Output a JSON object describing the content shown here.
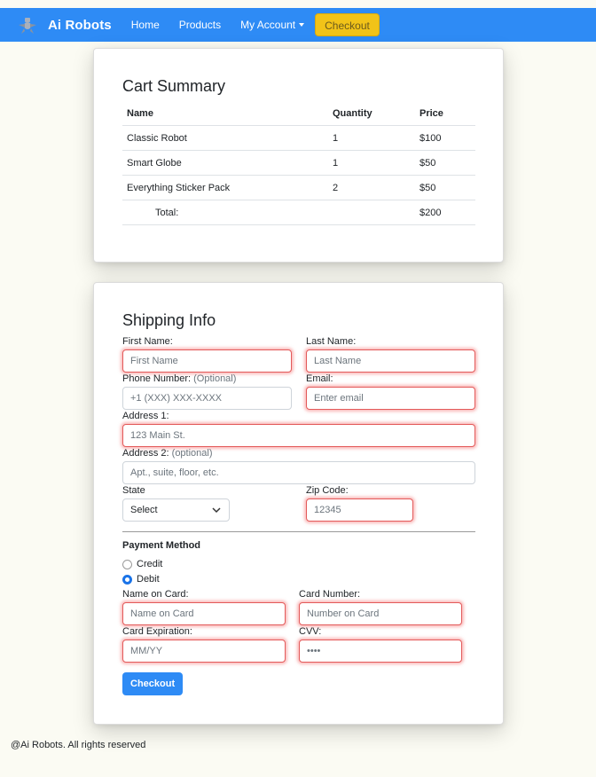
{
  "navbar": {
    "brand": "Ai Robots",
    "links": [
      "Home",
      "Products",
      "My Account"
    ],
    "checkout": "Checkout"
  },
  "cart": {
    "title": "Cart Summary",
    "headers": [
      "Name",
      "Quantity",
      "Price"
    ],
    "rows": [
      {
        "name": "Classic Robot",
        "qty": "1",
        "price": "$100"
      },
      {
        "name": "Smart Globe",
        "qty": "1",
        "price": "$50"
      },
      {
        "name": "Everything Sticker Pack",
        "qty": "2",
        "price": "$50"
      }
    ],
    "total_label": "Total:",
    "total_value": "$200"
  },
  "shipping": {
    "title": "Shipping Info",
    "first_name": {
      "label": "First Name:",
      "placeholder": "First Name"
    },
    "last_name": {
      "label": "Last Name:",
      "placeholder": "Last Name"
    },
    "phone": {
      "label": "Phone Number:",
      "optional": "(Optional)",
      "placeholder": "+1 (XXX) XXX-XXXX"
    },
    "email": {
      "label": "Email:",
      "placeholder": "Enter email"
    },
    "address1": {
      "label": "Address 1:",
      "placeholder": "123 Main St."
    },
    "address2": {
      "label": "Address 2:",
      "optional": "(optional)",
      "placeholder": "Apt., suite, floor, etc."
    },
    "state": {
      "label": "State",
      "value": "Select"
    },
    "zip": {
      "label": "Zip Code:",
      "placeholder": "12345"
    }
  },
  "payment": {
    "label": "Payment Method",
    "options": [
      "Credit",
      "Debit"
    ],
    "selected": "Debit",
    "name_on_card": {
      "label": "Name on Card:",
      "placeholder": "Name on Card"
    },
    "card_number": {
      "label": "Card Number:",
      "placeholder": "Number on Card"
    },
    "expiration": {
      "label": "Card Expiration:",
      "placeholder": "MM/YY"
    },
    "cvv": {
      "label": "CVV:",
      "placeholder": "••••"
    },
    "submit": "Checkout"
  },
  "footer": "@Ai Robots. All rights reserved",
  "colors": {
    "navbar": "#2e8bf5",
    "checkout_button": "#f2c318",
    "error_border": "#e35a5a",
    "primary": "#2e8bf5"
  }
}
